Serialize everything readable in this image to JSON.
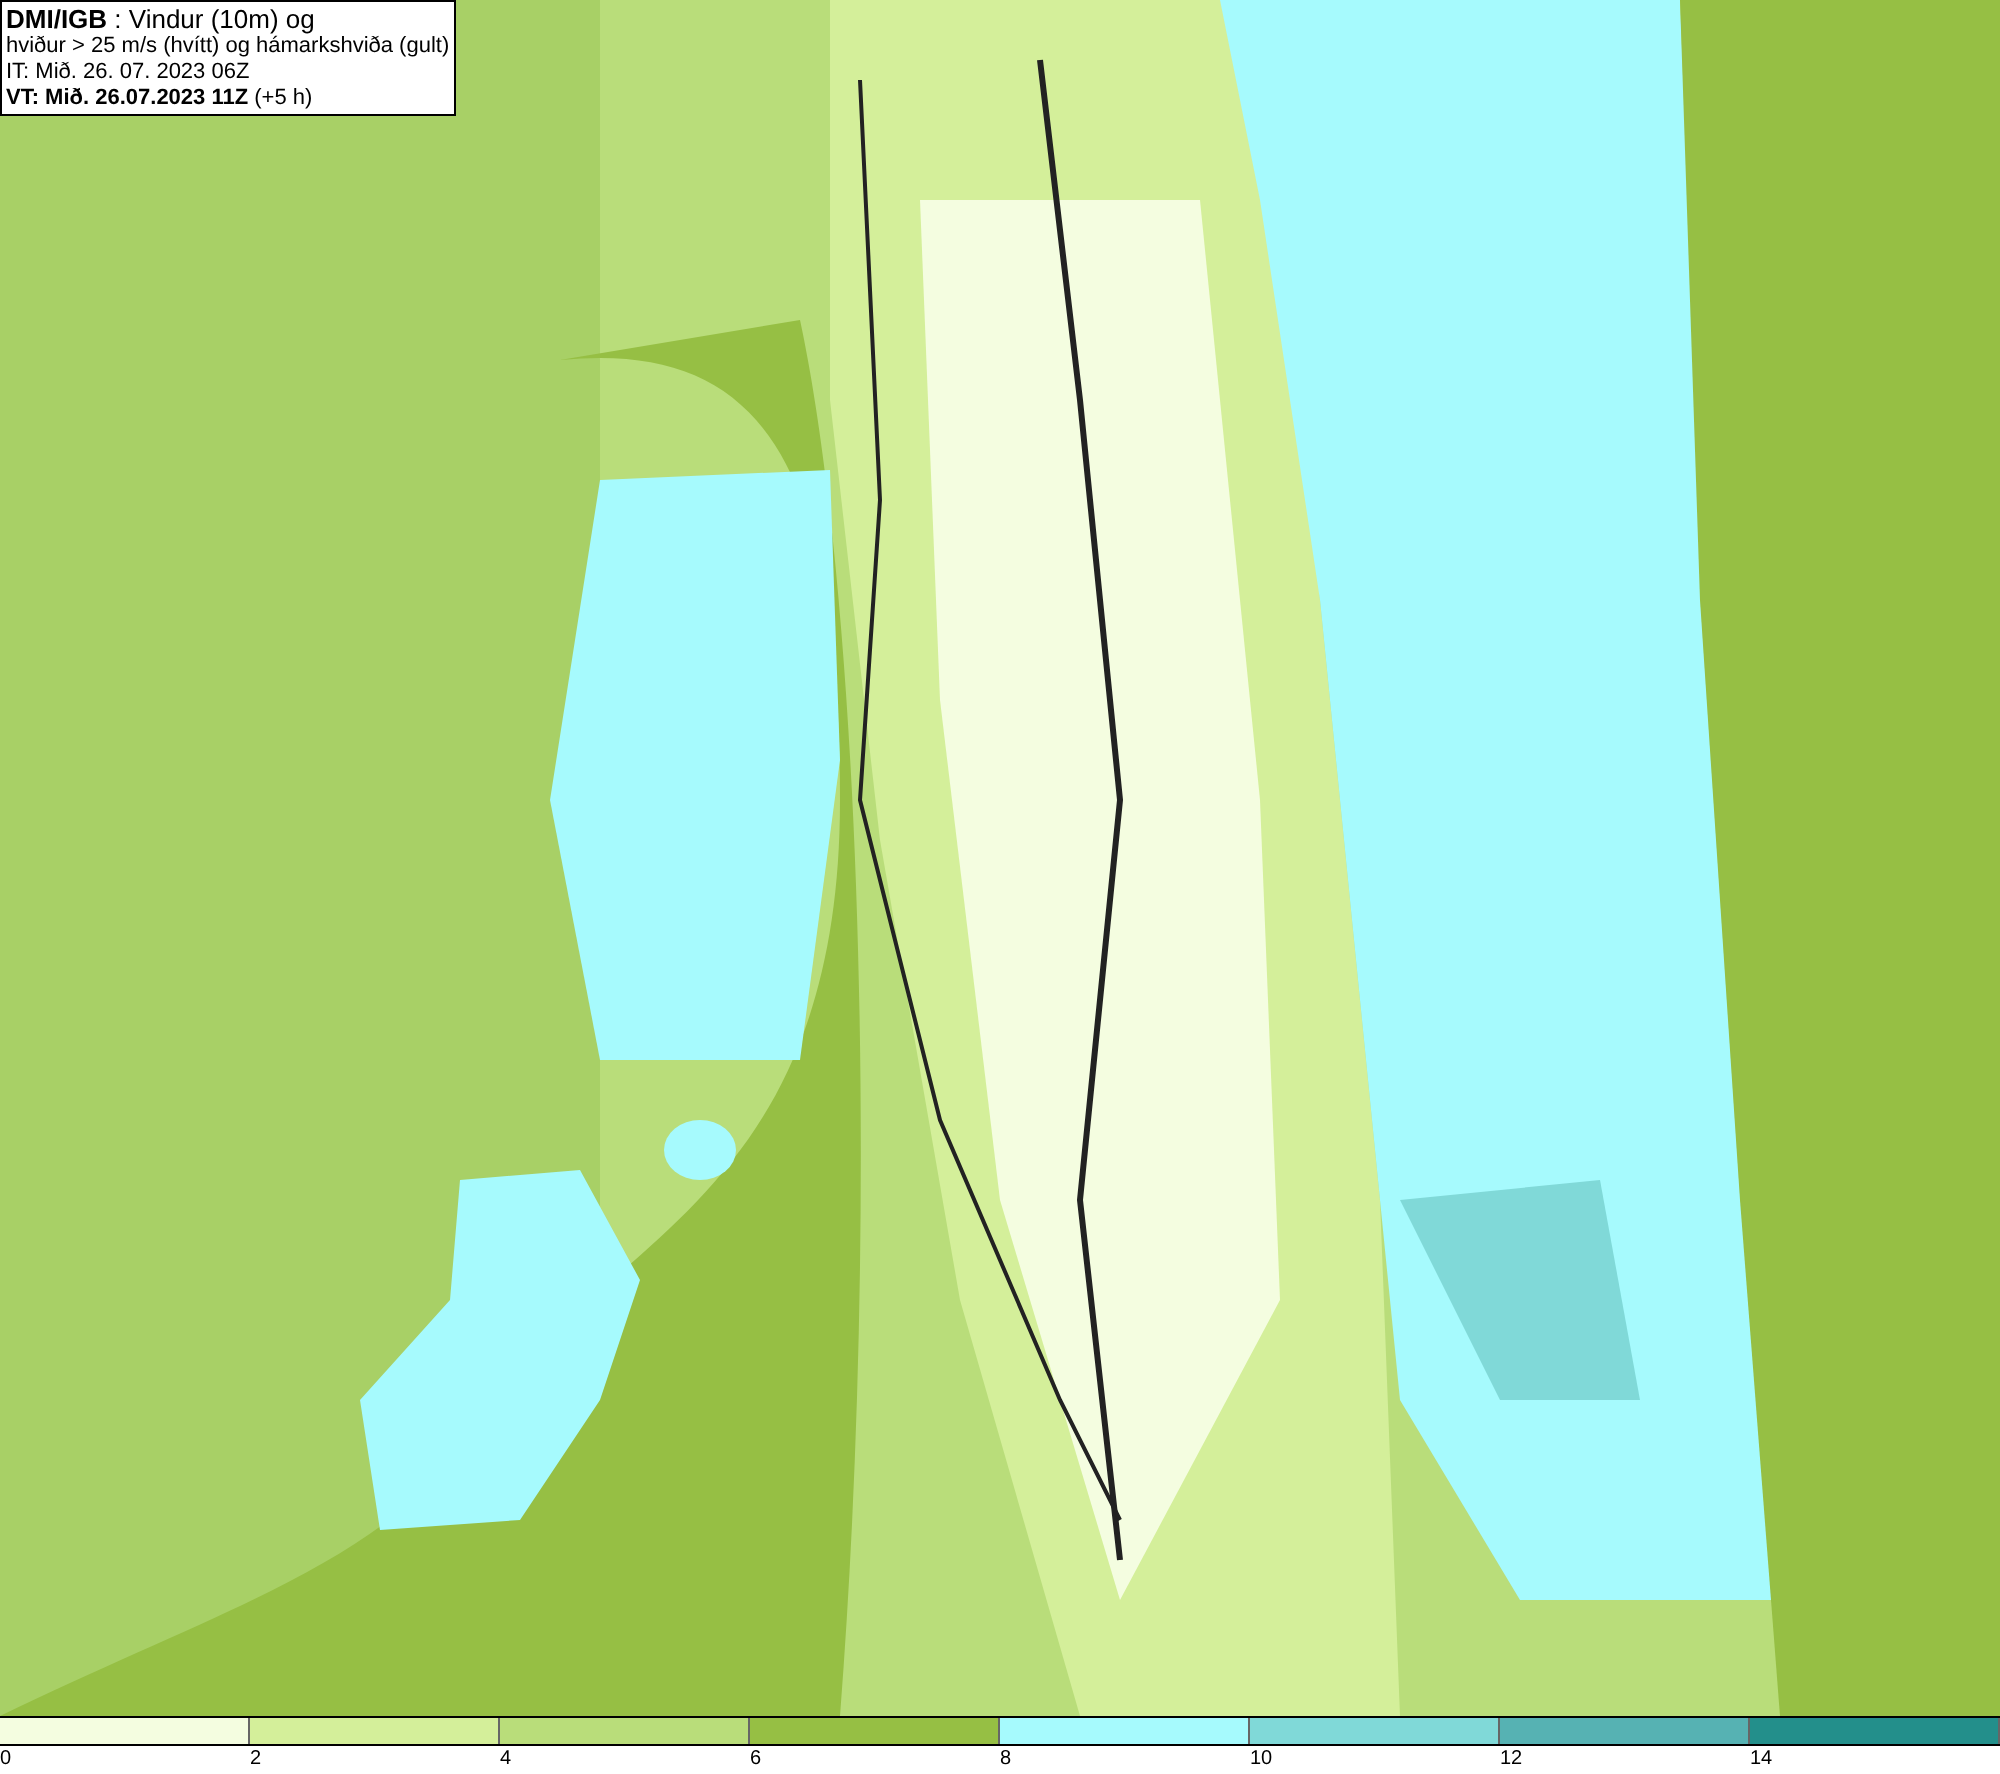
{
  "header": {
    "lines": [
      "**DMI/IGB** : Vindur (10m) og",
      "hviður > 25 m/s (hvítt) og hámarkshviða (gult)",
      "IT: Mið. 26. 07. 2023 06Z",
      "**VT: Mið. 26.07.2023 11Z** (+5 h)"
    ]
  },
  "legend": {
    "bins": [
      {
        "label": "0",
        "color": "#f4fde0"
      },
      {
        "label": "2",
        "color": "#d4ef9a"
      },
      {
        "label": "4",
        "color": "#b9dd7a"
      },
      {
        "label": "6",
        "color": "#96bf44"
      },
      {
        "label": "8",
        "color": "#a6fafd"
      },
      {
        "label": "10",
        "color": "#80d9d8"
      },
      {
        "label": "12",
        "color": "#56b2b3"
      },
      {
        "label": "14",
        "color": "#238f8b"
      }
    ]
  }
}
